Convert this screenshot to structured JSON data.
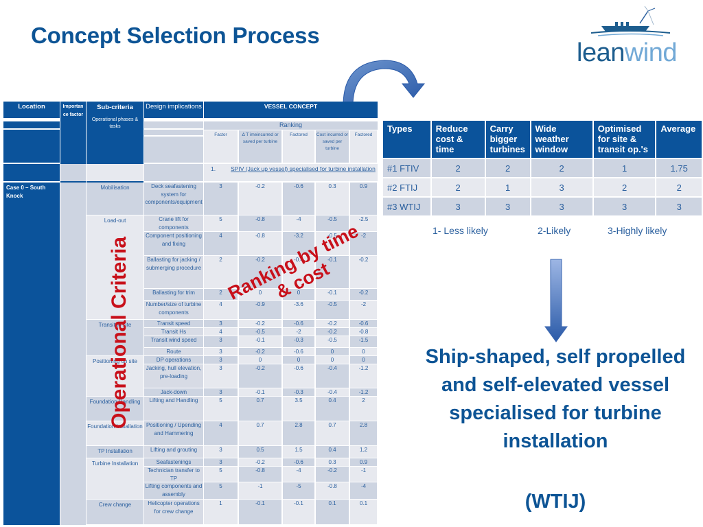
{
  "title": "Concept Selection Process",
  "logo": {
    "part1": "lean",
    "part2": "wind"
  },
  "left_table": {
    "headers": {
      "location": "Location",
      "importance": "Importan ce factor",
      "subcriteria": "Sub-criteria",
      "design": "Design implications",
      "vessel_concept": "VESSEL CONCEPT",
      "phases": "Operational phases & tasks",
      "ranking": "Ranking",
      "factor": "Factor",
      "dt": "Δ T imeincurred or saved per turbine",
      "factored1": "Factored",
      "cost": "Cost incurred or saved per turbine",
      "factored2": "Factored"
    },
    "concept_number": "1.",
    "concept_name": "SPIV (Jack up vessel) specialised for turbine installation",
    "location": "Case 0 – South Knock",
    "phases": [
      "Mobilisation",
      "Load-out",
      "Transit to site",
      "Positioning on site",
      "Foundation Handling",
      "Foundation Installation",
      "TP Installation",
      "Turbine Installation",
      "Crew change"
    ],
    "rows": [
      {
        "design": "Deck seafastening system for components/equipment",
        "factor": "3",
        "dt": "-0.2",
        "f1": "-0.6",
        "cost": "0.3",
        "f2": "0.9"
      },
      {
        "design": "Crane lift for components",
        "factor": "5",
        "dt": "-0.8",
        "f1": "-4",
        "cost": "-0.5",
        "f2": "-2.5"
      },
      {
        "design": "Component positioning and fixing",
        "factor": "4",
        "dt": "-0.8",
        "f1": "-3.2",
        "cost": "-0.5",
        "f2": "-2"
      },
      {
        "design": "Ballasting for jacking / submerging procedure",
        "factor": "2",
        "dt": "-0.2",
        "f1": "-0.4",
        "cost": "-0.1",
        "f2": "-0.2"
      },
      {
        "design": "Ballasting for trim",
        "factor": "2",
        "dt": "0",
        "f1": "0",
        "cost": "-0.1",
        "f2": "-0.2"
      },
      {
        "design": "Number/size of turbine components",
        "factor": "4",
        "dt": "-0.9",
        "f1": "-3.6",
        "cost": "-0.5",
        "f2": "-2"
      },
      {
        "design": "Transit speed",
        "factor": "3",
        "dt": "-0.2",
        "f1": "-0.6",
        "cost": "-0.2",
        "f2": "-0.6"
      },
      {
        "design": "Transit Hs",
        "factor": "4",
        "dt": "-0.5",
        "f1": "-2",
        "cost": "-0.2",
        "f2": "-0.8"
      },
      {
        "design": "Transit wind speed",
        "factor": "3",
        "dt": "-0.1",
        "f1": "-0.3",
        "cost": "-0.5",
        "f2": "-1.5"
      },
      {
        "design": "Route",
        "factor": "3",
        "dt": "-0.2",
        "f1": "-0.6",
        "cost": "0",
        "f2": "0"
      },
      {
        "design": "DP operations",
        "factor": "3",
        "dt": "0",
        "f1": "0",
        "cost": "0",
        "f2": "0"
      },
      {
        "design": "Jacking, hull elevation, pre-loading",
        "factor": "3",
        "dt": "-0.2",
        "f1": "-0.6",
        "cost": "-0.4",
        "f2": "-1.2"
      },
      {
        "design": "Jack-down",
        "factor": "3",
        "dt": "-0.1",
        "f1": "-0.3",
        "cost": "-0.4",
        "f2": "-1.2"
      },
      {
        "design": "Lifting and Handling",
        "factor": "5",
        "dt": "0.7",
        "f1": "3.5",
        "cost": "0.4",
        "f2": "2"
      },
      {
        "design": "Positioning / Upending and Hammering",
        "factor": "4",
        "dt": "0.7",
        "f1": "2.8",
        "cost": "0.7",
        "f2": "2.8"
      },
      {
        "design": "Lifting and grouting",
        "factor": "3",
        "dt": "0.5",
        "f1": "1.5",
        "cost": "0.4",
        "f2": "1.2"
      },
      {
        "design": "Seafastenings",
        "factor": "3",
        "dt": "-0.2",
        "f1": "-0.6",
        "cost": "0.3",
        "f2": "0.9"
      },
      {
        "design": "Technician transfer to TP",
        "factor": "5",
        "dt": "-0.8",
        "f1": "-4",
        "cost": "-0.2",
        "f2": "-1"
      },
      {
        "design": "Lifting components and assembly",
        "factor": "5",
        "dt": "-1",
        "f1": "-5",
        "cost": "-0.8",
        "f2": "-4"
      },
      {
        "design": "Helicopter operations for crew change",
        "factor": "1",
        "dt": "-0.1",
        "f1": "-0.1",
        "cost": "0.1",
        "f2": "0.1"
      }
    ]
  },
  "overlay": {
    "vertical": "Operational Criteria",
    "diagonal_line1": "Ranking by time",
    "diagonal_line2": "& cost"
  },
  "right_table": {
    "headers": [
      "Types",
      "Reduce cost & time",
      "Carry bigger turbines",
      "Wide weather window",
      "Optimised for site & transit op.'s",
      "Average"
    ],
    "rows": [
      [
        "#1 FTIV",
        "2",
        "2",
        "2",
        "1",
        "1.75"
      ],
      [
        "#2 FTIJ",
        "2",
        "1",
        "3",
        "2",
        "2"
      ],
      [
        "#3 WTIJ",
        "3",
        "3",
        "3",
        "3",
        "3"
      ]
    ]
  },
  "legend": [
    "1- Less likely",
    "2-Likely",
    "3-Highly likely"
  ],
  "conclusion": {
    "text": "Ship-shaped, self propelled and self-elevated vessel specialised for turbine installation",
    "code": "(WTIJ)"
  }
}
